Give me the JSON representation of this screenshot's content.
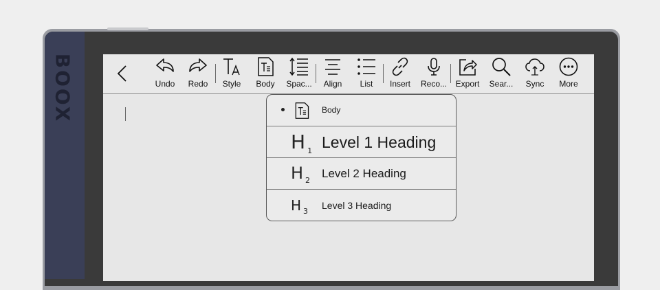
{
  "device": {
    "brand": "BOOX"
  },
  "toolbar": {
    "back_icon": "chevron-left-icon",
    "tools": [
      {
        "label": "Undo",
        "icon": "undo-icon"
      },
      {
        "label": "Redo",
        "icon": "redo-icon"
      },
      {
        "label": "Style",
        "icon": "text-style-icon"
      },
      {
        "label": "Body",
        "icon": "body-text-icon"
      },
      {
        "label": "Spac...",
        "icon": "line-spacing-icon"
      },
      {
        "label": "Align",
        "icon": "align-icon"
      },
      {
        "label": "List",
        "icon": "list-icon"
      },
      {
        "label": "Insert",
        "icon": "link-icon"
      },
      {
        "label": "Reco...",
        "icon": "microphone-icon"
      },
      {
        "label": "Export",
        "icon": "export-icon"
      },
      {
        "label": "Sear...",
        "icon": "search-icon"
      },
      {
        "label": "Sync",
        "icon": "cloud-sync-icon"
      },
      {
        "label": "More",
        "icon": "more-icon"
      }
    ]
  },
  "style_menu": {
    "selected": "Body",
    "items": [
      {
        "label": "Body",
        "glyph": "",
        "sub": ""
      },
      {
        "label": "Level 1 Heading",
        "glyph": "H",
        "sub": "1"
      },
      {
        "label": "Level 2 Heading",
        "glyph": "H",
        "sub": "2"
      },
      {
        "label": "Level 3 Heading",
        "glyph": "H",
        "sub": "3"
      }
    ]
  }
}
